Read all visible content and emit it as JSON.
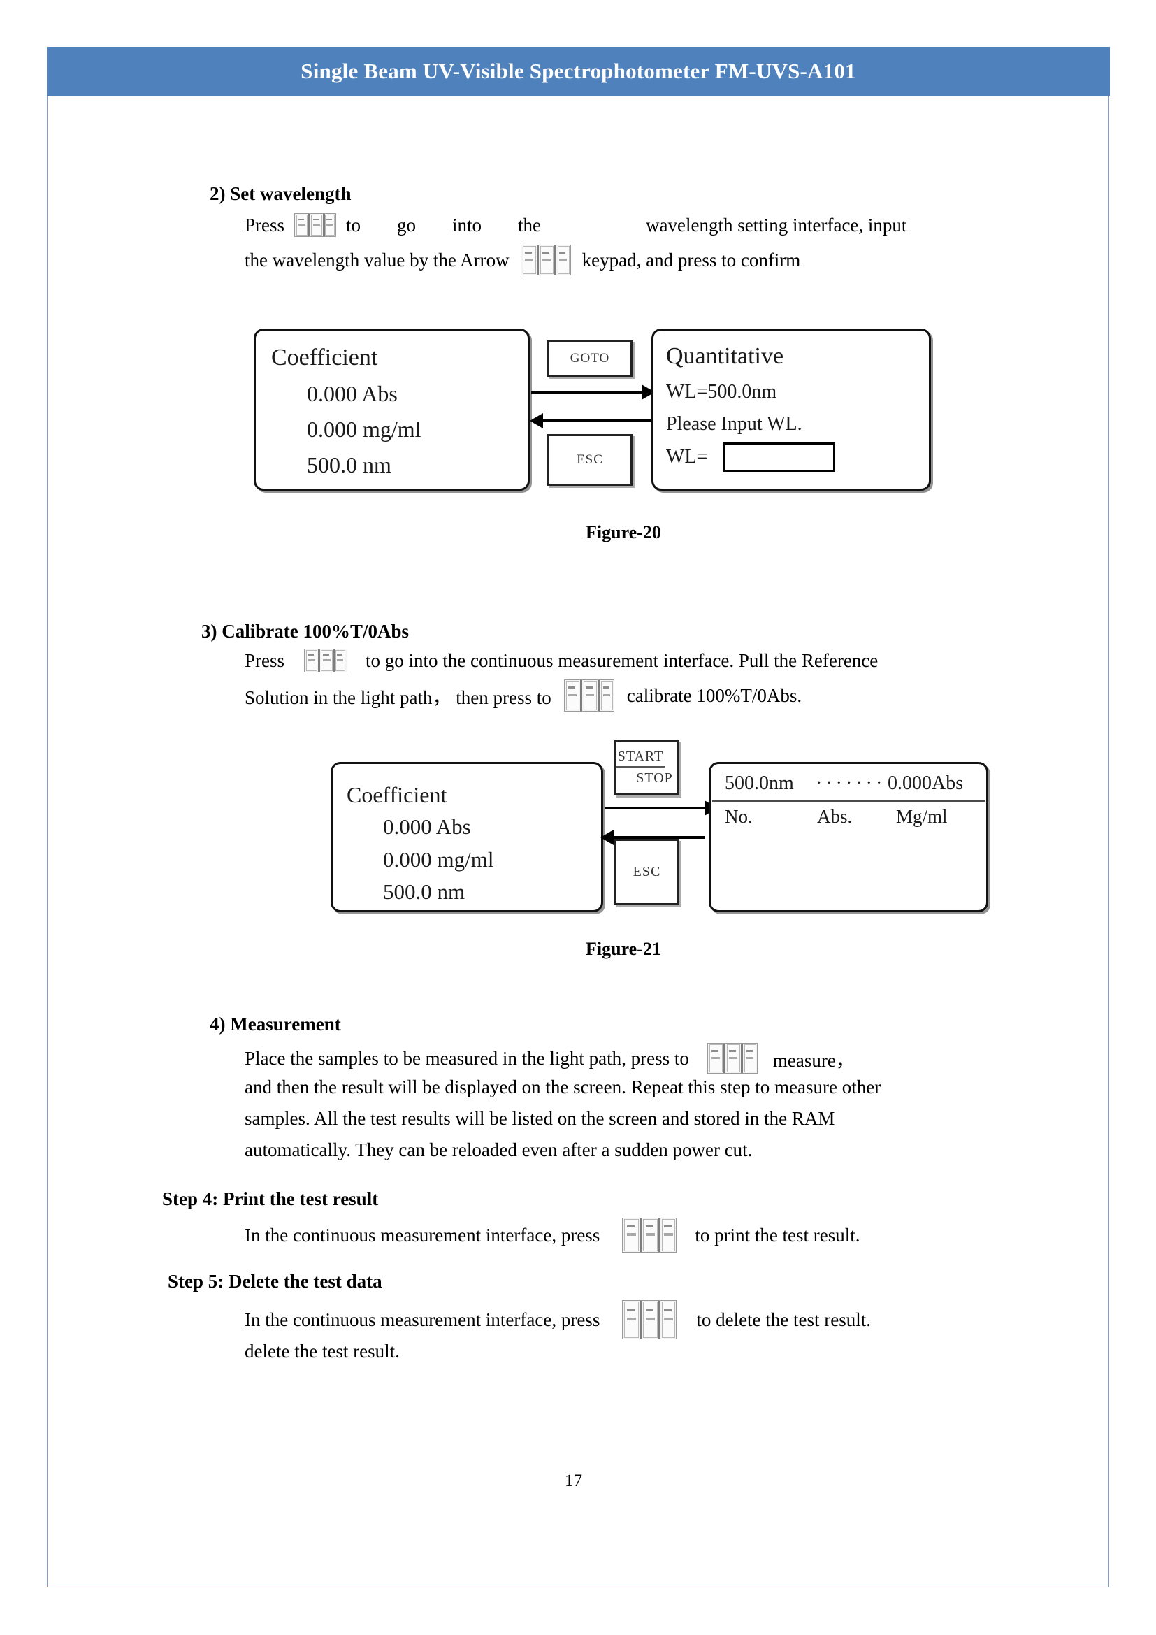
{
  "header": {
    "title": "Single Beam UV-Visible Spectrophotometer FM-UVS-A101"
  },
  "colors": {
    "header_bar": "#4F81BD",
    "page_border": "#7BA0D0",
    "text": "#000000"
  },
  "sections": {
    "set_wavelength": {
      "heading": "2)  Set wavelength",
      "line1_a": "Press",
      "line1_b": "to",
      "line1_c": "go",
      "line1_d": "into",
      "line1_e": "the",
      "line1_f": "wavelength  setting  interface,  input",
      "line2_a": "the  wavelength  value  by  the  Arrow",
      "line2_b": "keypad, and press to confirm",
      "key_icon_1": "keypad-key-icon",
      "key_icon_2": "keypad-key-icon"
    },
    "calibrate": {
      "heading": "3)  Calibrate 100%T/0Abs",
      "line1_a": "Press",
      "line1_b": "to go into the  continuous  measurement  interface.  Pull  the  Reference",
      "line2_a": "Solution   in   the   light path，   then    press  to",
      "line2_b": "calibrate 100%T/0Abs.",
      "key_icon_1": "keypad-key-icon",
      "key_icon_2": "keypad-key-icon"
    },
    "measurement": {
      "heading": "4)  Measurement",
      "line1_a": "Place the samples to be measured in the light path, press to",
      "line1_b": "measure，",
      "line2": "and then the result will be displayed on the screen. Repeat this step to  measure  other",
      "line3": "samples.   All   the   test   results   will   be   listed   on   the   screen   and   stored  in the  RAM",
      "line4": "automatically. They can be reloaded even after a sudden power cut.",
      "key_icon": "keypad-key-icon"
    },
    "step4": {
      "heading": "Step 4: Print the test result",
      "line1_a": "In the continuous measurement interface, press",
      "line1_b": "to print the test result.",
      "key_icon": "keypad-key-icon"
    },
    "step5": {
      "heading": "Step 5: Delete the test data",
      "line1_a": "In the continuous measurement interface, press",
      "line1_b": "to delete the test result.",
      "line2": "delete the test result.",
      "key_icon": "keypad-key-icon"
    }
  },
  "figure20": {
    "caption": "Figure-20",
    "left_screen": {
      "title": "Coefficient",
      "row1": "0.000 Abs",
      "row2": "0.000 mg/ml",
      "row3": "500.0 nm"
    },
    "goto_button": "GOTO",
    "esc_button": "ESC",
    "right_screen": {
      "title": "Quantitative",
      "row1": "WL=500.0nm",
      "row2": "Please Input WL.",
      "row3": "WL=",
      "input_value": ""
    }
  },
  "figure21": {
    "caption": "Figure-21",
    "left_screen": {
      "title": "Coefficient",
      "row1": "0.000 Abs",
      "row2": "0.000 mg/ml",
      "row3": "500.0 nm"
    },
    "start_stop_button": {
      "start": "START",
      "stop": "STOP"
    },
    "esc_button": "ESC",
    "right_screen": {
      "header_left": "500.0nm",
      "header_dots": "·······",
      "header_right": "0.000Abs",
      "col1": "No.",
      "col2": "Abs.",
      "col3": "Mg/ml"
    }
  },
  "footer": {
    "page_number": "17"
  }
}
